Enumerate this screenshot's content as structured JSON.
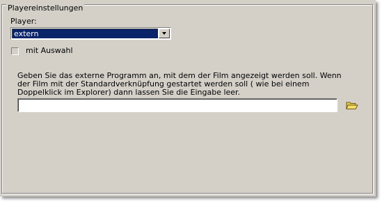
{
  "group": {
    "title": "Playereinstellungen"
  },
  "player": {
    "label": "Player:",
    "selected": "extern"
  },
  "selection_checkbox": {
    "label": "mit Auswahl",
    "checked": false
  },
  "info_text": "Geben Sie das externe Programm an, mit dem der Film angezeigt werden soll. Wenn der Film mit der Standardverknüpfung gestartet werden soll ( wie bei einem Doppelklick im Explorer) dann lassen Sie die Eingabe leer.",
  "program_path": {
    "value": ""
  },
  "icons": {
    "browse": "open-folder-icon",
    "dropdown": "chevron-down-icon"
  },
  "colors": {
    "panel": "#d4d0c8",
    "selection": "#0a246a",
    "folder": "#e8c64a"
  }
}
